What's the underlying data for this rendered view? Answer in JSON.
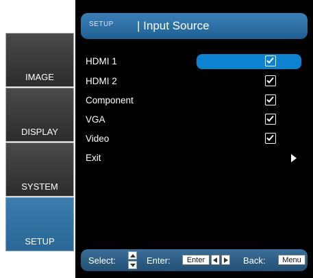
{
  "sidebar": {
    "tabs": [
      {
        "label": "IMAGE",
        "active": false
      },
      {
        "label": "DISPLAY",
        "active": false
      },
      {
        "label": "SYSTEM",
        "active": false
      },
      {
        "label": "SETUP",
        "active": true
      }
    ]
  },
  "header": {
    "section": "SETUP",
    "title": "| Input Source"
  },
  "rows": [
    {
      "label": "HDMI 1",
      "checked": true,
      "selected": true
    },
    {
      "label": "HDMI 2",
      "checked": true
    },
    {
      "label": "Component",
      "checked": true
    },
    {
      "label": "VGA",
      "checked": true
    },
    {
      "label": "Video",
      "checked": true
    },
    {
      "label": "Exit",
      "control": "right-arrow-icon"
    }
  ],
  "footer": {
    "select_label": "Select:",
    "enter_label": "Enter:",
    "enter_key": "Enter",
    "back_label": "Back:",
    "menu_key": "Menu"
  },
  "colors": {
    "accent": "#2b6fa5",
    "selected_row": "#0d82cf",
    "panel_bg": "#000000"
  }
}
